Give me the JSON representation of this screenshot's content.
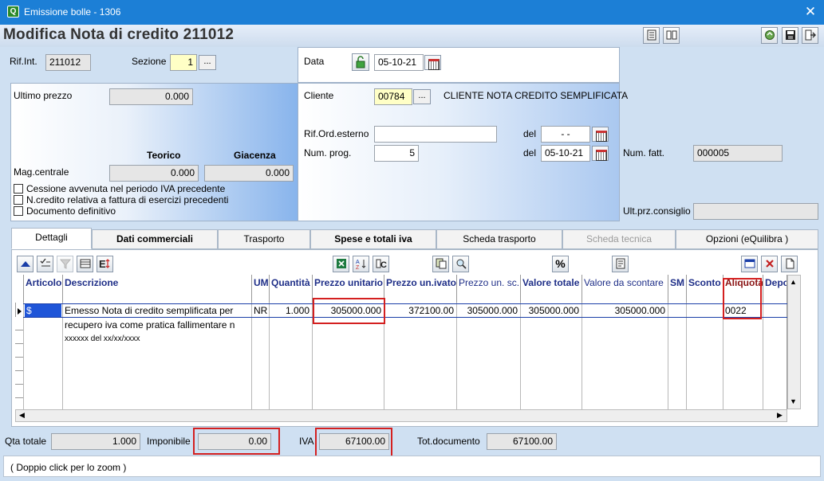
{
  "window": {
    "title": "Emissione bolle - 1306",
    "close_glyph": "✕"
  },
  "header": {
    "title": "Modifica Nota di credito 211012"
  },
  "doc": {
    "rif_int_label": "Rif.Int.",
    "rif_int": "211012",
    "sezione_label": "Sezione",
    "sezione": "1",
    "data_label": "Data",
    "data": "05-10-21",
    "cliente_label": "Cliente",
    "cliente_code": "00784",
    "cliente_name": "CLIENTE NOTA CREDITO SEMPLIFICATA",
    "rif_ord_label": "Rif.Ord.esterno",
    "rif_ord": "",
    "del_label": "del",
    "rif_ord_date": "- -",
    "num_prog_label": "Num. prog.",
    "num_prog": "5",
    "num_prog_date": "05-10-21",
    "num_fatt_label": "Num. fatt.",
    "num_fatt": "000005",
    "ult_prz_label": "Ult.prz.consiglio",
    "ult_prz": ""
  },
  "left": {
    "ultimo_prezzo_label": "Ultimo prezzo",
    "ultimo_prezzo": "0.000",
    "teorico_label": "Teorico",
    "giacenza_label": "Giacenza",
    "mag_label": "Mag.centrale",
    "teorico": "0.000",
    "giacenza": "0.000",
    "checks": [
      "Cessione avvenuta nel periodo IVA precedente",
      "N.credito relativa a fattura di esercizi precedenti",
      "Documento definitivo"
    ]
  },
  "tabs": [
    "Dettagli",
    "Dati commerciali",
    "Trasporto",
    "Spese e totali iva",
    "Scheda trasporto",
    "Scheda tecnica",
    "Opzioni (eQuilibra )"
  ],
  "grid": {
    "columns": [
      "Articolo",
      "Descrizione",
      "UM",
      "Quantità",
      "Prezzo unitario",
      "Prezzo un.ivato",
      "Prezzo un. sc.",
      "Valore totale",
      "Valore da scontare",
      "SM",
      "Sconto",
      "Aliquota",
      "Depo"
    ],
    "row": {
      "articolo": "$",
      "descrizione": [
        "Emesso Nota di credito semplificata per",
        "recupero iva come pratica fallimentare n",
        "xxxxxx del xx/xx/xxxx"
      ],
      "um": "NR",
      "quantita": "1.000",
      "prezzo_unitario": "305000.000",
      "prezzo_ivato": "372100.00",
      "prezzo_sc": "305000.000",
      "valore_totale": "305000.000",
      "valore_da_scontare": "305000.000",
      "sm": "",
      "sconto": "",
      "aliquota": "0022"
    },
    "percent_label": "%"
  },
  "totals": {
    "qta_label": "Qta totale",
    "qta": "1.000",
    "imponibile_label": "Imponibile",
    "imponibile": "0.00",
    "iva_label": "IVA",
    "iva": "67100.00",
    "tot_label": "Tot.documento",
    "tot": "67100.00"
  },
  "status": {
    "text": "( Doppio click per lo zoom )"
  }
}
